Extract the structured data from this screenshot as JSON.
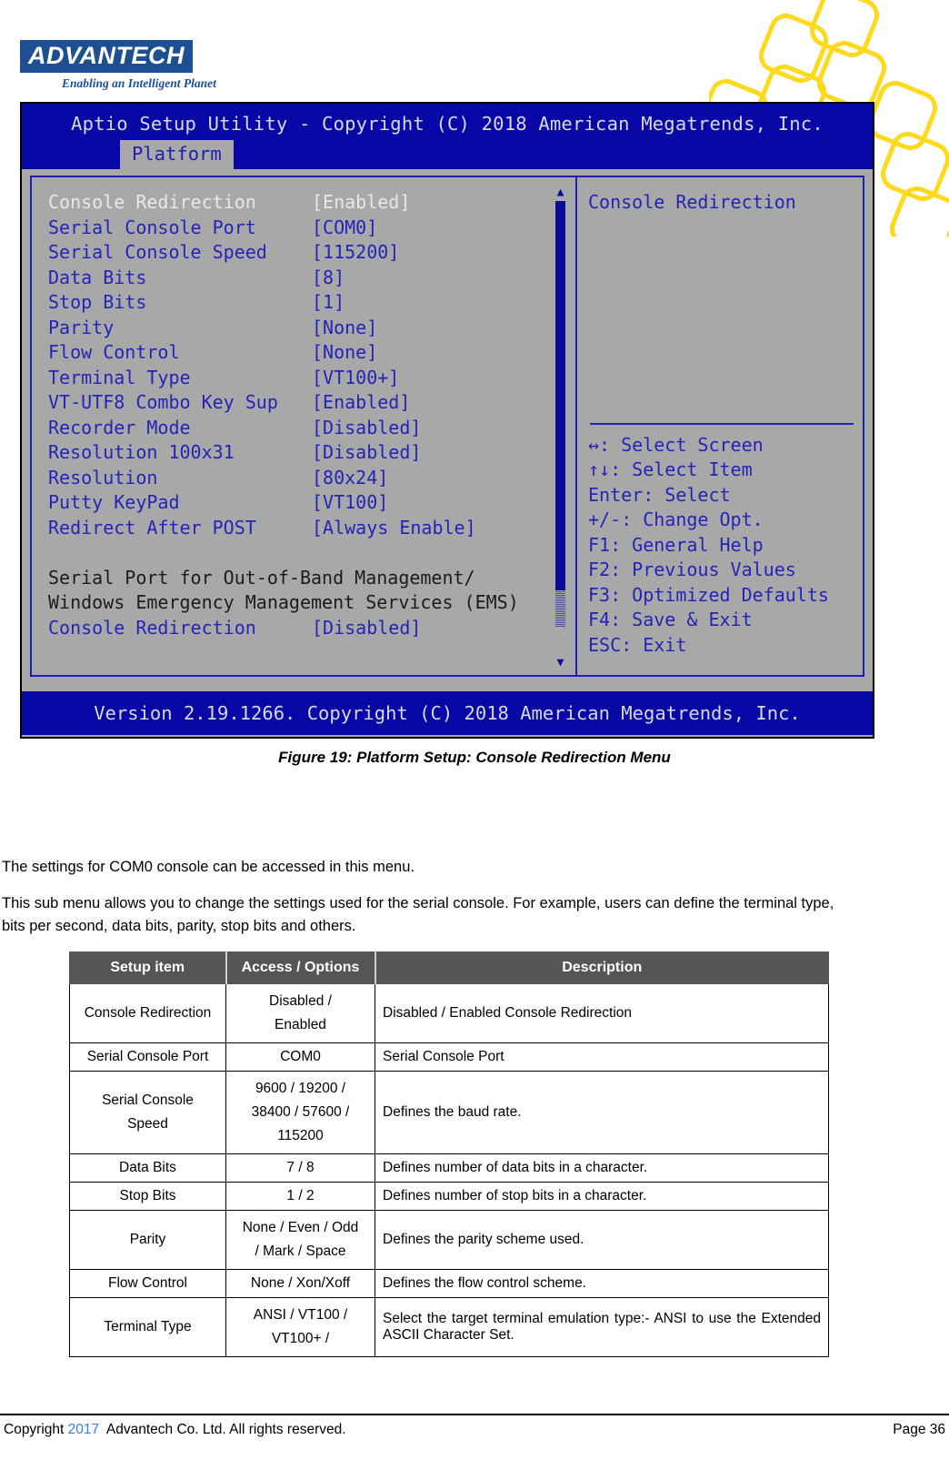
{
  "brand": {
    "logo_text": "ADVANTECH",
    "tagline": "Enabling an Intelligent Planet",
    "logo_color": "#1d4f91",
    "deco_color": "#ffd91c"
  },
  "bios": {
    "title": "Aptio Setup Utility - Copyright (C) 2018 American Megatrends, Inc.",
    "tab": "Platform",
    "footer": "Version 2.19.1266. Copyright (C) 2018 American Megatrends, Inc.",
    "colors": {
      "header_bg": "#0707a8",
      "body_bg": "#a8a8a8",
      "text": "#2424b8",
      "selected_text": "#e8e8e8"
    },
    "settings": [
      {
        "label": "Console Redirection",
        "value": "[Enabled]",
        "selected": true
      },
      {
        "label": "Serial Console Port",
        "value": "[COM0]",
        "selected": false
      },
      {
        "label": "Serial Console Speed",
        "value": "[115200]",
        "selected": false
      },
      {
        "label": "Data Bits",
        "value": "[8]",
        "selected": false
      },
      {
        "label": "Stop Bits",
        "value": "[1]",
        "selected": false
      },
      {
        "label": "Parity",
        "value": "[None]",
        "selected": false
      },
      {
        "label": "Flow Control",
        "value": "[None]",
        "selected": false
      },
      {
        "label": "Terminal Type",
        "value": "[VT100+]",
        "selected": false
      },
      {
        "label": "VT-UTF8 Combo Key Sup",
        "value": "[Enabled]",
        "selected": false
      },
      {
        "label": "Recorder Mode",
        "value": "[Disabled]",
        "selected": false
      },
      {
        "label": "Resolution 100x31",
        "value": "[Disabled]",
        "selected": false
      },
      {
        "label": "Resolution",
        "value": "[80x24]",
        "selected": false
      },
      {
        "label": "Putty KeyPad",
        "value": "[VT100]",
        "selected": false
      },
      {
        "label": "Redirect After POST",
        "value": "[Always Enable]",
        "selected": false
      }
    ],
    "section_heading_line1": "Serial Port for Out-of-Band Management/",
    "section_heading_line2": "Windows Emergency Management Services (EMS)",
    "ems_item": {
      "label": "Console Redirection",
      "value": "[Disabled]"
    },
    "help_title": "Console Redirection",
    "help_keys": [
      "↔: Select Screen",
      "↑↓: Select Item",
      "Enter: Select",
      "+/-: Change Opt.",
      "F1: General Help",
      "F2: Previous Values",
      "F3: Optimized Defaults",
      "F4: Save & Exit",
      "ESC: Exit"
    ],
    "scroll_up_icon": "▲",
    "scroll_down_icon": "▼"
  },
  "figure": {
    "caption": "Figure 19: Platform Setup: Console Redirection Menu"
  },
  "body": {
    "para1": "The settings for COM0 console can be accessed in this menu.",
    "para2": "This sub menu allows you to change the settings used for the serial console. For example, users can define the terminal type, bits per second, data bits, parity, stop bits and others."
  },
  "table": {
    "headers": [
      "Setup item",
      "Access / Options",
      "Description"
    ],
    "rows": [
      {
        "item": "Console Redirection",
        "options": "Disabled /\nEnabled",
        "description": "Disabled / Enabled Console Redirection",
        "desc_align": "mid"
      },
      {
        "item": "Serial Console Port",
        "options": "COM0",
        "description": "Serial Console Port",
        "desc_align": "mid"
      },
      {
        "item": "Serial Console\nSpeed",
        "options": "9600 / 19200 /\n38400 / 57600 /\n115200",
        "description": "Defines the baud rate.",
        "desc_align": "top"
      },
      {
        "item": "Data Bits",
        "options": "7 / 8",
        "description": "Defines number of data bits in a character.",
        "desc_align": "mid"
      },
      {
        "item": "Stop Bits",
        "options": "1 / 2",
        "description": "Defines number of stop bits in a character.",
        "desc_align": "mid"
      },
      {
        "item": "Parity",
        "options": "None / Even / Odd\n/ Mark / Space",
        "description": "Defines the parity scheme used.",
        "desc_align": "mid"
      },
      {
        "item": "Flow Control",
        "options": "None / Xon/Xoff",
        "description": "Defines the flow control scheme.",
        "desc_align": "mid"
      },
      {
        "item": "Terminal Type",
        "options": "ANSI / VT100 /\nVT100+ /",
        "description": "Select the target terminal emulation type:-  ANSI to use the Extended ASCII Character Set.",
        "desc_align": "just"
      }
    ]
  },
  "page_footer": {
    "copyright_prefix": "Copyright ",
    "year": "2017",
    "copyright_suffix": "  Advantech Co. Ltd. All rights reserved.",
    "page_number": "Page 36"
  }
}
